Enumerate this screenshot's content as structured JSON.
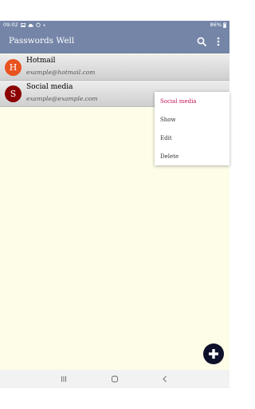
{
  "status_bar": {
    "time": "09:02",
    "left_icons": [
      "gallery-icon",
      "cloud-icon",
      "sync-icon",
      "dot-icon"
    ],
    "battery": "86%"
  },
  "app_bar": {
    "title": "Passwords Well",
    "actions": [
      "search-icon",
      "more-vert-icon"
    ]
  },
  "entries": [
    {
      "initial": "H",
      "title": "Hotmail",
      "subtitle": "example@hotmail.com",
      "avatar_color": "#e8531f"
    },
    {
      "initial": "S",
      "title": "Social media",
      "subtitle": "example@example.com",
      "avatar_color": "#8b0000"
    }
  ],
  "context_menu": {
    "title": "Social media",
    "items": [
      "Show",
      "Edit",
      "Delete"
    ]
  },
  "fab": {
    "icon": "plus-icon"
  },
  "nav_bar": {
    "buttons": [
      "recents-icon",
      "home-icon",
      "back-icon"
    ]
  },
  "colors": {
    "primary": "#7585a8",
    "background": "#fdfde8",
    "fab": "#0e1129",
    "menu_title": "#c2185b"
  }
}
